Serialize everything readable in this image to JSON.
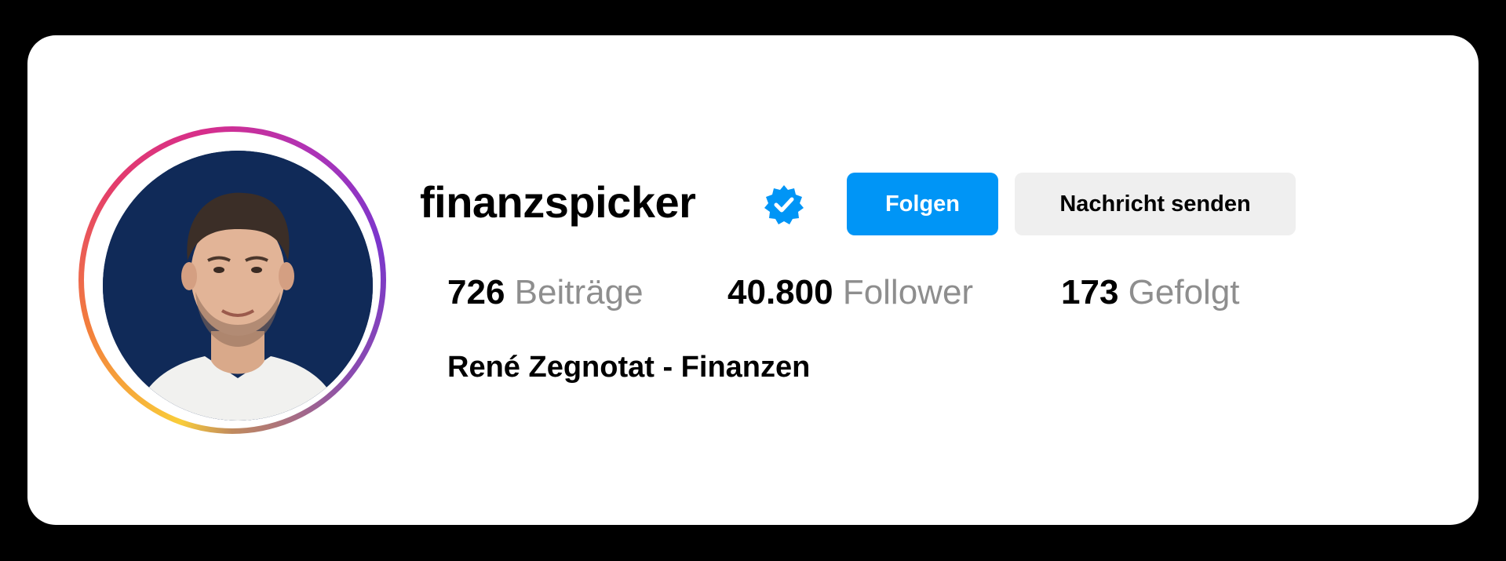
{
  "profile": {
    "username": "finanzspicker",
    "verified_icon": "verified-badge-icon",
    "full_name": "René Zegnotat - Finanzen",
    "avatar_icon": "profile-photo"
  },
  "actions": {
    "follow_label": "Folgen",
    "message_label": "Nachricht senden"
  },
  "stats": {
    "posts": {
      "value": "726",
      "label": "Beiträge"
    },
    "followers": {
      "value": "40.800",
      "label": "Follower"
    },
    "following": {
      "value": "173",
      "label": "Gefolgt"
    }
  },
  "colors": {
    "accent": "#0095f6",
    "secondary_button": "#efefef",
    "muted_text": "#8e8e8e",
    "avatar_background": "#102a58"
  }
}
